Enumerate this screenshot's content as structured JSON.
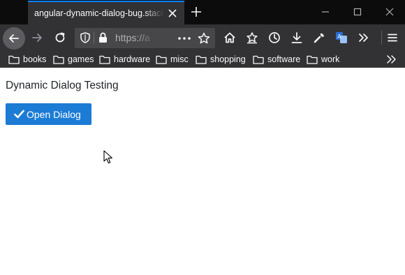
{
  "browser": {
    "tab": {
      "title": "angular-dynamic-dialog-bug.stackblitz.io"
    },
    "url": "https://a",
    "bookmarks": [
      {
        "label": "books"
      },
      {
        "label": "games"
      },
      {
        "label": "hardware"
      },
      {
        "label": "misc"
      },
      {
        "label": "shopping"
      },
      {
        "label": "software"
      },
      {
        "label": "work"
      }
    ],
    "icons": {
      "tab_close": "close-icon",
      "new_tab": "plus-icon",
      "back": "back-arrow-icon",
      "forward": "forward-arrow-icon",
      "reload": "reload-icon",
      "home": "home-icon",
      "library": "library-icon",
      "history": "clock-icon",
      "downloads": "download-icon",
      "tools": "wrench-icon",
      "translate": "translate-icon",
      "overflow": "double-chevron-icon",
      "menu": "hamburger-icon",
      "bookmark_folder": "folder-icon"
    },
    "colors": {
      "tab_accent": "#0a84ff",
      "chrome": "#323234",
      "tabstrip": "#0c0c0d"
    }
  },
  "page": {
    "title": "Dynamic Dialog Testing",
    "open_button": {
      "label": "Open Dialog",
      "icon": "check-icon",
      "color": "#1c7cd5"
    }
  }
}
